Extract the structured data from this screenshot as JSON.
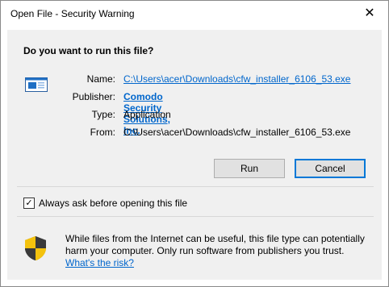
{
  "window": {
    "title": "Open File - Security Warning",
    "close_glyph": "✕"
  },
  "prompt": "Do you want to run this file?",
  "details": {
    "name_label": "Name:",
    "name_value": "C:\\Users\\acer\\Downloads\\cfw_installer_6106_53.exe",
    "publisher_label": "Publisher:",
    "publisher_value": "Comodo Security Solutions, Inc.",
    "type_label": "Type:",
    "type_value": "Application",
    "from_label": "From:",
    "from_value": "C:\\Users\\acer\\Downloads\\cfw_installer_6106_53.exe"
  },
  "buttons": {
    "run": "Run",
    "cancel": "Cancel"
  },
  "checkbox": {
    "label": "Always ask before opening this file",
    "checked": true,
    "check_glyph": "✓"
  },
  "warning": {
    "text": "While files from the Internet can be useful, this file type can potentially harm your computer. Only run software from publishers you trust.",
    "link": "What's the risk?"
  },
  "icons": {
    "file": "application-file-icon",
    "warning": "security-shield-icon"
  },
  "colors": {
    "link": "#0066cc",
    "dialog_bg": "#f0f0f0",
    "default_button_border": "#0078d7",
    "shield_yellow": "#f4c20d"
  }
}
